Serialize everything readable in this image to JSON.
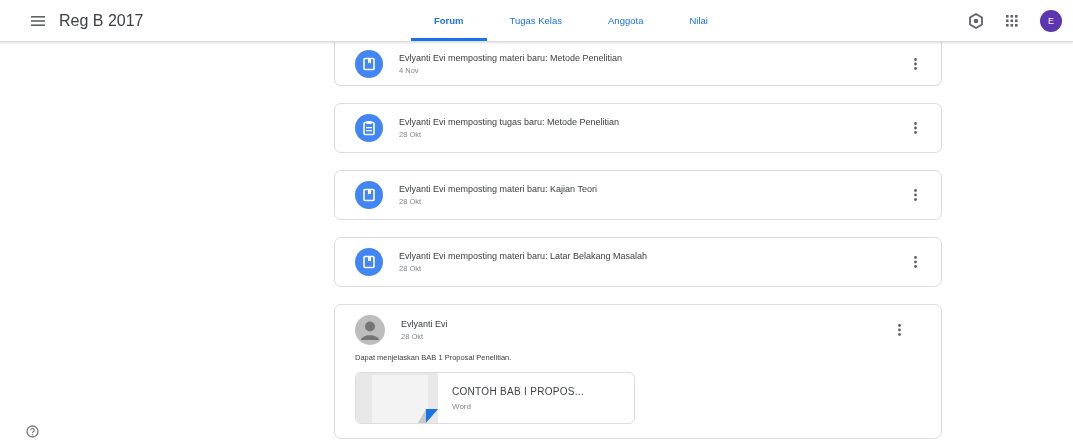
{
  "header": {
    "title": "Reg B 2017",
    "avatar": "E"
  },
  "tabs": [
    {
      "label": "Forum",
      "selected": true
    },
    {
      "label": "Tugas Kelas",
      "selected": false
    },
    {
      "label": "Anggota",
      "selected": false
    },
    {
      "label": "Nilai",
      "selected": false
    }
  ],
  "stream": [
    {
      "kind": "material",
      "text": "Evlyanti Evi memposting materi baru: Metode Penelitian",
      "date": "4 Nov"
    },
    {
      "kind": "assignment",
      "text": "Evlyanti Evi memposting tugas baru: Metode Penelitian",
      "date": "28 Okt"
    },
    {
      "kind": "material",
      "text": "Evlyanti Evi memposting materi baru: Kajian Teori",
      "date": "28 Okt"
    },
    {
      "kind": "material",
      "text": "Evlyanti Evi memposting materi baru: Latar Belakang Masalah",
      "date": "28 Okt"
    }
  ],
  "announcement": {
    "author": "Evlyanti Evi",
    "date": "28 Okt",
    "body": "Dapat menjelaskan BAB 1 Proposal Penelitian.",
    "attachment": {
      "title": "CONTOH BAB I PROPOS...",
      "type": "Word"
    }
  }
}
